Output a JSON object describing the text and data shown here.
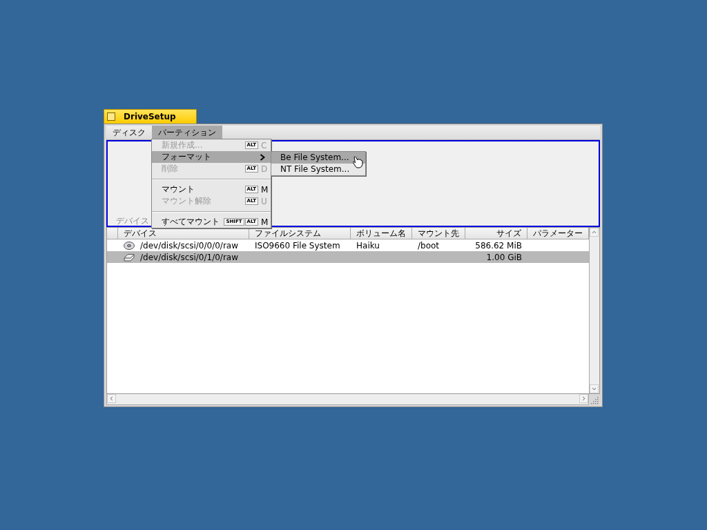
{
  "window": {
    "title": "DriveSetup"
  },
  "menu_bar": [
    {
      "label": "ディスク",
      "selected": false
    },
    {
      "label": "パーティション",
      "selected": true
    }
  ],
  "disk_map": {
    "label": "デバイス"
  },
  "menu": [
    {
      "kind": "item",
      "label": "新規作成...",
      "disabled": true,
      "highlighted": false,
      "submenu": false,
      "modifiers": [
        "ALT"
      ],
      "key": "C"
    },
    {
      "kind": "item",
      "label": "フォーマット",
      "disabled": false,
      "highlighted": true,
      "submenu": true
    },
    {
      "kind": "item",
      "label": "削除",
      "disabled": true,
      "highlighted": false,
      "submenu": false,
      "modifiers": [
        "ALT"
      ],
      "key": "D"
    },
    {
      "kind": "separator"
    },
    {
      "kind": "item",
      "label": "マウント",
      "disabled": false,
      "highlighted": false,
      "submenu": false,
      "modifiers": [
        "ALT"
      ],
      "key": "M"
    },
    {
      "kind": "item",
      "label": "マウント解除",
      "disabled": true,
      "highlighted": false,
      "submenu": false,
      "modifiers": [
        "ALT"
      ],
      "key": "U"
    },
    {
      "kind": "separator"
    },
    {
      "kind": "item",
      "label": "すべてマウント",
      "disabled": false,
      "highlighted": false,
      "submenu": false,
      "modifiers": [
        "SHIFT",
        "ALT"
      ],
      "key": "M"
    }
  ],
  "submenu": [
    {
      "label": "Be File System...",
      "highlighted": true
    },
    {
      "label": "NT File System...",
      "highlighted": false
    }
  ],
  "table": {
    "columns": [
      "デバイス",
      "ファイルシステム",
      "ボリューム名",
      "マウント先",
      "サイズ",
      "パラメーター"
    ],
    "rows": [
      {
        "kind": "cd",
        "selected": false,
        "cells": [
          "/dev/disk/scsi/0/0/0/raw",
          "ISO9660 File System",
          "Haiku",
          "/boot",
          "586.62 MiB",
          ""
        ]
      },
      {
        "kind": "disk",
        "selected": true,
        "cells": [
          "/dev/disk/scsi/0/1/0/raw",
          "",
          "",
          "",
          "1.00 GiB",
          ""
        ]
      }
    ]
  }
}
